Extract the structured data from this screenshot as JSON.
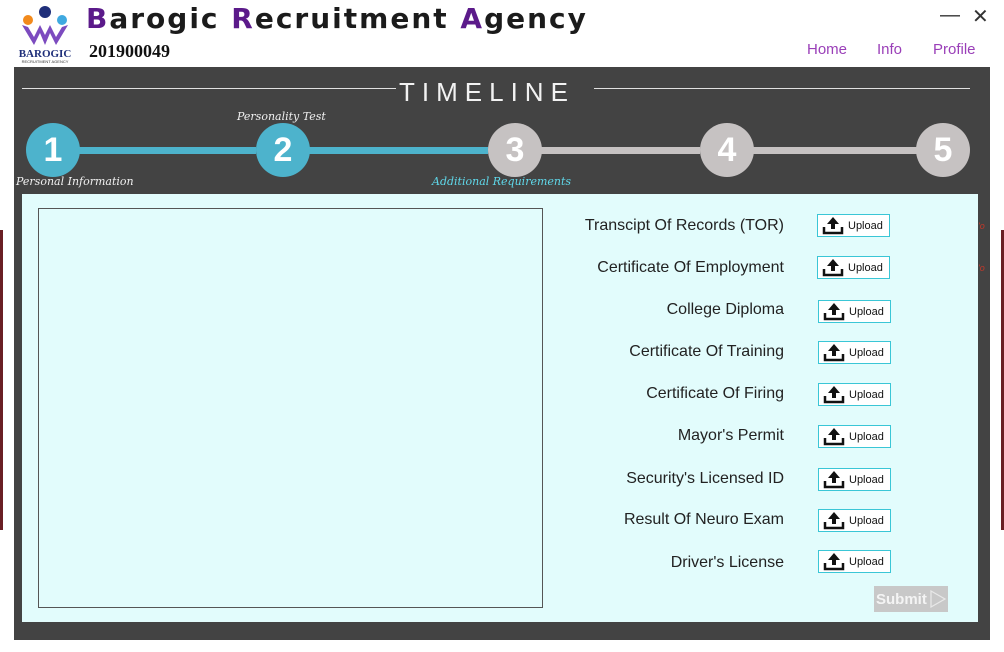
{
  "app": {
    "title_parts": [
      {
        "cap": "B",
        "rest": "arogic "
      },
      {
        "cap": "R",
        "rest": "ecruitment "
      },
      {
        "cap": "A",
        "rest": "gency"
      }
    ],
    "logo_text": "BAROGIC",
    "logo_sub": "RECRUITMENT AGENCY",
    "user_id": "201900049"
  },
  "window": {
    "minimize": "—",
    "close": "✕"
  },
  "nav": {
    "home": "Home",
    "info": "Info",
    "profile": "Profile"
  },
  "timeline": {
    "title": "TIMELINE",
    "steps": [
      {
        "number": "1",
        "label": "Personal Information",
        "state": "done"
      },
      {
        "number": "2",
        "label": "Personality Test",
        "state": "done"
      },
      {
        "number": "3",
        "label": "Additional Requirements",
        "state": "current"
      },
      {
        "number": "4",
        "label": "",
        "state": "pending"
      },
      {
        "number": "5",
        "label": "",
        "state": "pending"
      }
    ]
  },
  "requirements": [
    {
      "label": "Transcipt Of Records (TOR)",
      "button": "Upload",
      "mark": "'o"
    },
    {
      "label": "Certificate Of Employment",
      "button": "Upload",
      "mark": "'o"
    },
    {
      "label": "College Diploma",
      "button": "Upload",
      "mark": ""
    },
    {
      "label": "Certificate Of Training",
      "button": "Upload",
      "mark": ""
    },
    {
      "label": "Certificate Of Firing",
      "button": "Upload",
      "mark": ""
    },
    {
      "label": "Mayor's Permit",
      "button": "Upload",
      "mark": ""
    },
    {
      "label": "Security's Licensed ID",
      "button": "Upload",
      "mark": ""
    },
    {
      "label": "Result Of Neuro Exam",
      "button": "Upload",
      "mark": ""
    },
    {
      "label": "Driver's License",
      "button": "Upload",
      "mark": ""
    }
  ],
  "submit": {
    "label": "Submit"
  },
  "colors": {
    "accent": "#4db3cc",
    "pending": "#c6c2c2",
    "panel": "#434343",
    "content_bg": "#e2fcfc",
    "nav": "#9a3fb8",
    "title_caps": "#5b1a8a"
  },
  "icons": {
    "upload": "upload-icon",
    "submit": "arrow-right-icon"
  }
}
